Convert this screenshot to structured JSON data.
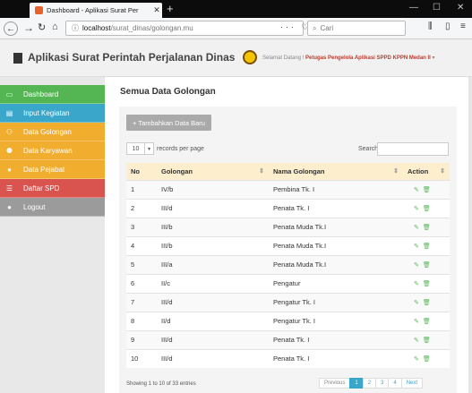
{
  "browser": {
    "tab_title": "Dashboard - Aplikasi Surat Per",
    "url_host": "localhost",
    "url_path": "/surat_dinas/golongan.mu",
    "search_placeholder": "Cari",
    "url_actions": "··· ♡ ☆"
  },
  "header": {
    "title": "Aplikasi Surat Perintah Perjalanan Dinas",
    "welcome_prefix": "Selamat Datang ! ",
    "welcome_user": "Petugas Pengelola Aplikasi SPPD KPPN Medan II",
    "welcome_caret": "▾"
  },
  "sidebar": {
    "items": [
      {
        "label": "Dashboard",
        "icon": "monitor-icon"
      },
      {
        "label": "Input Kegiatan",
        "icon": "book-icon"
      },
      {
        "label": "Data Golongan",
        "icon": "users-icon"
      },
      {
        "label": "Data Karyawan",
        "icon": "group-icon"
      },
      {
        "label": "Data Pejabat",
        "icon": "user-icon"
      },
      {
        "label": "Daftar SPD",
        "icon": "list-icon"
      },
      {
        "label": "Logout",
        "icon": "logout-icon"
      }
    ]
  },
  "main": {
    "title": "Semua Data Golongan",
    "add_button": "+ Tambahkan Data Baru",
    "page_length": "10",
    "records_per_page": "records per page",
    "search_label": "Search:",
    "columns": [
      "No",
      "Golongan",
      "Nama Golongan",
      "Action"
    ],
    "rows": [
      {
        "no": "1",
        "golongan": "IV/b",
        "nama": "Pembina Tk. I"
      },
      {
        "no": "2",
        "golongan": "III/d",
        "nama": "Penata Tk. I"
      },
      {
        "no": "3",
        "golongan": "III/b",
        "nama": "Penata Muda Tk.I"
      },
      {
        "no": "4",
        "golongan": "III/b",
        "nama": "Penata Muda Tk.I"
      },
      {
        "no": "5",
        "golongan": "III/a",
        "nama": "Penata Muda Tk.I"
      },
      {
        "no": "6",
        "golongan": "II/c",
        "nama": "Pengatur"
      },
      {
        "no": "7",
        "golongan": "III/d",
        "nama": "Pengatur Tk. I"
      },
      {
        "no": "8",
        "golongan": "II/d",
        "nama": "Pengatur Tk. I"
      },
      {
        "no": "9",
        "golongan": "III/d",
        "nama": "Penata Tk. I"
      },
      {
        "no": "10",
        "golongan": "III/d",
        "nama": "Penata Tk. I"
      }
    ],
    "showing": "Showing 1 to 10 of 33 entries",
    "pager": {
      "prev": "Previous",
      "pages": [
        "1",
        "2",
        "3",
        "4"
      ],
      "next": "Next",
      "current": "1"
    }
  }
}
